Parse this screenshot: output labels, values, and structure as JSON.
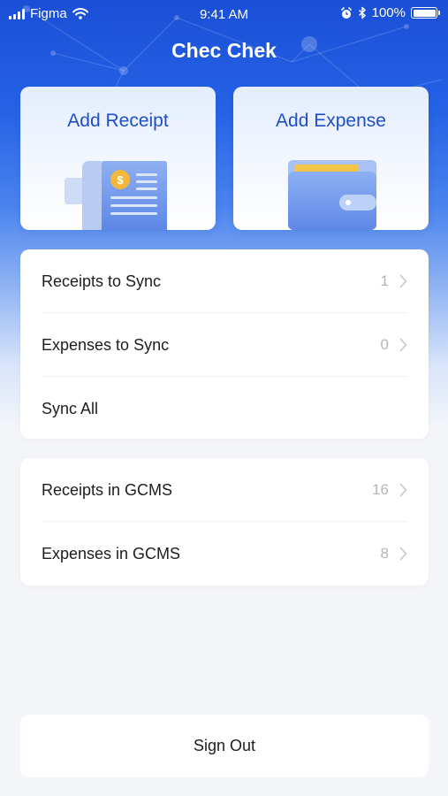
{
  "status_bar": {
    "carrier": "Figma",
    "time": "9:41 AM",
    "battery": "100%",
    "battery_level": 1.0,
    "icons": [
      "signal-icon",
      "wifi-icon",
      "alarm-icon",
      "bluetooth-icon",
      "battery-icon"
    ]
  },
  "header": {
    "title": "Chec Chek"
  },
  "actions": {
    "add_receipt": {
      "label": "Add Receipt",
      "icon": "receipt-icon"
    },
    "add_expense": {
      "label": "Add Expense",
      "icon": "wallet-icon"
    }
  },
  "sync": {
    "items": [
      {
        "label": "Receipts to Sync",
        "count": "1"
      },
      {
        "label": "Expenses to Sync",
        "count": "0"
      },
      {
        "label": "Sync All"
      }
    ]
  },
  "gcms": {
    "items": [
      {
        "label": "Receipts in GCMS",
        "count": "16"
      },
      {
        "label": "Expenses in GCMS",
        "count": "8"
      }
    ]
  },
  "sign_out": {
    "label": "Sign Out"
  },
  "colors": {
    "brand_blue": "#1a4fd6",
    "label_blue": "#1e4fc9",
    "coin_gold": "#f5b73a",
    "muted_count": "#b3b5bb"
  }
}
